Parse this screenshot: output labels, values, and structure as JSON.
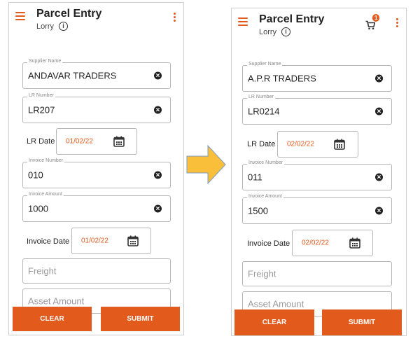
{
  "left": {
    "title": "Parcel Entry",
    "subtitle": "Lorry",
    "supplier": {
      "label": "Supplier Name",
      "value": "ANDAVAR TRADERS"
    },
    "lr_number": {
      "label": "LR Number",
      "value": "LR207"
    },
    "lr_date": {
      "label": "LR Date",
      "value": "01/02/22"
    },
    "invoice_number": {
      "label": "Invoice Number",
      "value": "010"
    },
    "invoice_amount": {
      "label": "Invoice Amount",
      "value": "1000"
    },
    "invoice_date": {
      "label": "Invoice Date",
      "value": "01/02/22"
    },
    "freight": {
      "placeholder": "Freight"
    },
    "asset_amount": {
      "placeholder": "Asset Amount"
    },
    "clear_label": "CLEAR",
    "submit_label": "SUBMIT"
  },
  "right": {
    "title": "Parcel Entry",
    "subtitle": "Lorry",
    "cart_count": "1",
    "supplier": {
      "label": "Supplier Name",
      "value": "A.P.R TRADERS"
    },
    "lr_number": {
      "label": "LR Number",
      "value": "LR0214"
    },
    "lr_date": {
      "label": "LR Date",
      "value": "02/02/22"
    },
    "invoice_number": {
      "label": "Invoice Number",
      "value": "011"
    },
    "invoice_amount": {
      "label": "Invoice Amount",
      "value": "1500"
    },
    "invoice_date": {
      "label": "Invoice Date",
      "value": "02/02/22"
    },
    "freight": {
      "placeholder": "Freight"
    },
    "asset_amount": {
      "placeholder": "Asset Amount"
    },
    "clear_label": "CLEAR",
    "submit_label": "SUBMIT"
  },
  "colors": {
    "accent": "#e35a1d",
    "arrow": "#f9bf3b"
  },
  "icons": [
    "menu-icon",
    "info-icon",
    "more-vert-icon",
    "cart-icon",
    "clear-circle-icon",
    "calendar-icon",
    "arrow-right-icon"
  ]
}
